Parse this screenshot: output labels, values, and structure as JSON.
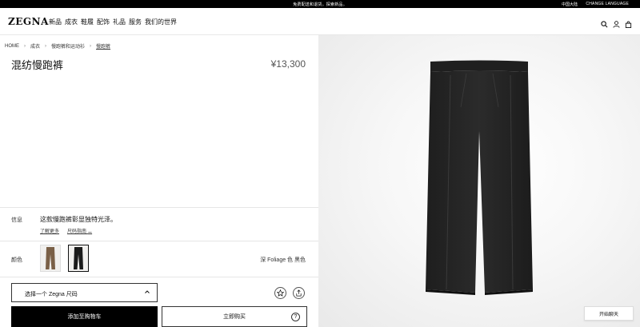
{
  "topbar": {
    "promo": "免费配送和退货。探索新品。",
    "region": "中国大陆",
    "language": "CHANGE LANGUAGE"
  },
  "header": {
    "logo": "ZEGNA",
    "nav": [
      "新品",
      "成衣",
      "鞋履",
      "配饰",
      "礼品",
      "服务",
      "我们的世界"
    ],
    "icons": [
      "search-icon",
      "user-icon",
      "shopping-bag-icon"
    ]
  },
  "breadcrumb": [
    "HOME",
    "成衣",
    "慢跑裤和运动衫",
    "慢跑裤"
  ],
  "product": {
    "title": "混纺慢跑裤",
    "price": "¥13,300"
  },
  "info": {
    "label": "信息",
    "text": "这款慢跑裤彰显独特光泽。",
    "learn_more": "了解更多",
    "size_guide": "尺码指南"
  },
  "color": {
    "label": "颜色",
    "selected_name": "深 Foliage 色  黑色",
    "swatches": [
      "brown",
      "black"
    ]
  },
  "size_select": {
    "placeholder": "选择一个 Zegna 尺码"
  },
  "actions": {
    "add_to_cart": "添加至购物车",
    "buy_now": "立即购买",
    "help": "?"
  },
  "chat": {
    "label": "开始聊天"
  }
}
